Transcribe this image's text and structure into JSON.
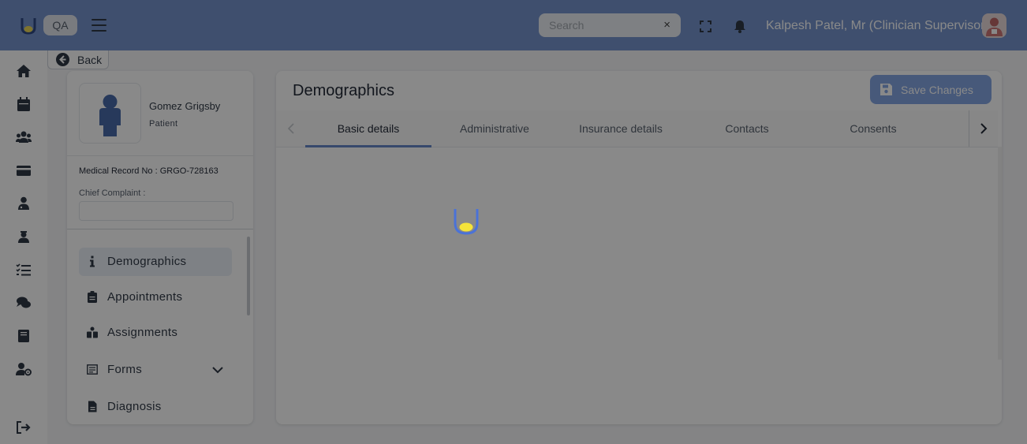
{
  "header": {
    "env_badge": "QA",
    "search_placeholder": "Search",
    "search_clear": "×",
    "user_name": "Kalpesh Patel, Mr (Clinician Supervisor)"
  },
  "rail": {
    "items": [
      "home-icon",
      "calendar-icon",
      "users-icon",
      "card-icon",
      "doctor-icon",
      "nurse-icon",
      "task-list-icon",
      "chat-icon",
      "book-icon",
      "user-settings-icon",
      "logout-icon"
    ]
  },
  "back": {
    "label": "Back"
  },
  "patient": {
    "name": "Gomez Grigsby",
    "role": "Patient",
    "mrn": "Medical Record No : GRGO-728163",
    "chief_complaint_label": "Chief Complaint :",
    "chief_complaint_value": ""
  },
  "menu": {
    "items": [
      {
        "label": "Demographics",
        "icon": "info-icon",
        "active": true
      },
      {
        "label": "Appointments",
        "icon": "clipboard-icon"
      },
      {
        "label": "Assignments",
        "icon": "assignment-icon"
      },
      {
        "label": "Forms",
        "icon": "form-icon",
        "expandable": true
      },
      {
        "label": "Diagnosis",
        "icon": "document-icon"
      }
    ]
  },
  "main": {
    "title": "Demographics",
    "save_label": "Save Changes",
    "tabs": [
      "Basic details",
      "Administrative",
      "Insurance details",
      "Contacts",
      "Consents"
    ],
    "active_tab": "Basic details"
  },
  "colors": {
    "topbar": "#6a8bc9",
    "accent": "#5b7fc4",
    "save_button": "#7b9fe0",
    "loader_blue": "#4a72d8",
    "loader_yellow": "#f5e33a"
  },
  "state": {
    "loading": true
  }
}
